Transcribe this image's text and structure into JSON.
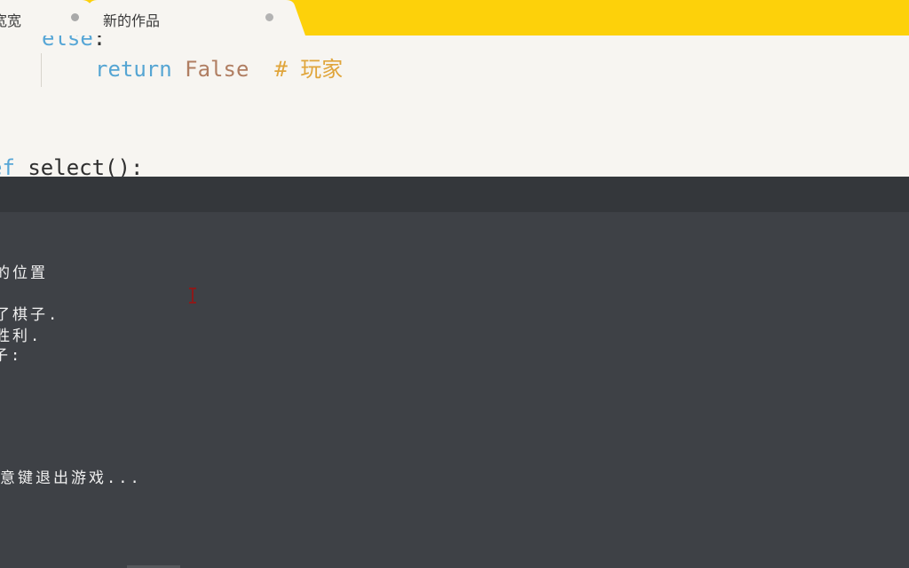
{
  "tabs": [
    {
      "label": "宽宽",
      "active": false
    },
    {
      "label": "新的作品",
      "active": true
    }
  ],
  "editor": {
    "line_else": {
      "keyword": "else",
      "punct": ":"
    },
    "line_return": {
      "keyword": "return",
      "value": "False",
      "comment": "# 玩家"
    },
    "line_def": {
      "keyword": "ef",
      "rest": " select():"
    }
  },
  "terminal": {
    "lines": [
      "的位置",
      "了棋子.",
      "胜利.",
      "子:",
      "意键退出游戏..."
    ]
  },
  "colors": {
    "tabbar": "#fdd10a",
    "editor_bg": "#f7f5f1",
    "terminal_bg": "#3e4146",
    "keyword": "#56a6d6",
    "literal": "#b07e62",
    "comment": "#e0a53b"
  },
  "icons": {
    "tab_close": "tab-close-icon",
    "cursor": "text-cursor-icon"
  }
}
